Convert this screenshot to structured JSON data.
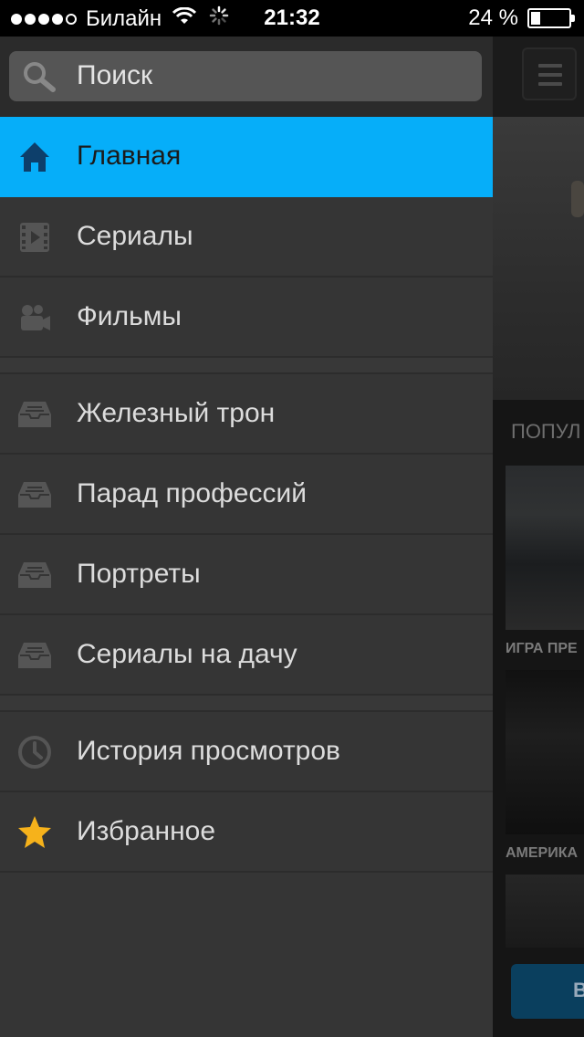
{
  "status": {
    "carrier": "Билайн",
    "time": "21:32",
    "battery_text": "24 %",
    "battery_level": 0.24,
    "signal_bars_filled": 4,
    "signal_bars_total": 5
  },
  "search": {
    "placeholder": "Поиск"
  },
  "menu": {
    "main": [
      {
        "label": "Главная",
        "icon": "home-icon",
        "active": true
      },
      {
        "label": "Сериалы",
        "icon": "film-strip-icon"
      },
      {
        "label": "Фильмы",
        "icon": "movie-camera-icon"
      }
    ],
    "collections": [
      {
        "label": "Железный трон",
        "icon": "tray-icon"
      },
      {
        "label": "Парад профессий",
        "icon": "tray-icon"
      },
      {
        "label": "Портреты",
        "icon": "tray-icon"
      },
      {
        "label": "Сериалы на дачу",
        "icon": "tray-icon"
      }
    ],
    "personal": [
      {
        "label": "История просмотров",
        "icon": "clock-icon"
      },
      {
        "label": "Избранное",
        "icon": "star-icon"
      }
    ]
  },
  "background": {
    "section_label": "ПОПУЛ",
    "poster_titles": [
      "ИГРА ПРЕ",
      "АМЕРИКА"
    ],
    "button_label": "В"
  },
  "colors": {
    "accent": "#06aef9",
    "drawer_bg": "#353535",
    "star": "#f6b21b"
  }
}
